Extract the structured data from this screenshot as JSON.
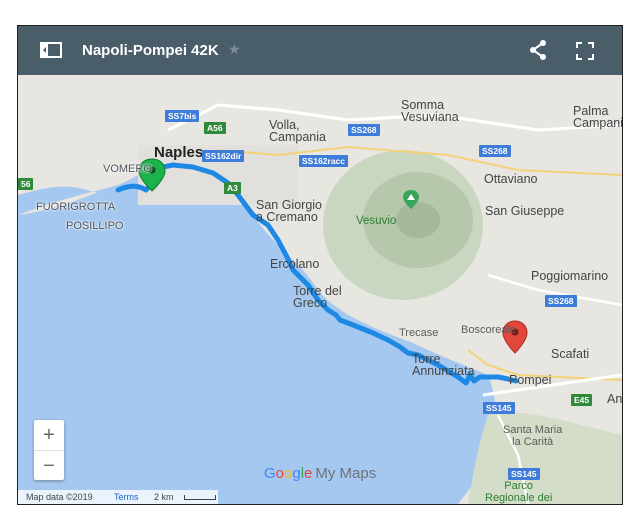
{
  "header": {
    "title": "Napoli-Pompei 42K",
    "star_glyph": "★",
    "bg_color": "#4a5e6a"
  },
  "map": {
    "places": {
      "naples": "Naples",
      "volla": "Volla,\nCampania",
      "somma": "Somma\nVesuviana",
      "ottaviano": "Ottaviano",
      "san_giuseppe": "San Giuseppe",
      "palma": "Palma\nCampania",
      "san_giorgio": "San Giorgio\na Cremano",
      "vesuvio": "Vesuvio",
      "ercolano": "Ercolano",
      "torre_greco": "Torre del\nGreco",
      "poggiomarino": "Poggiomarino",
      "trecase": "Trecase",
      "boscoreale": "Boscoreale",
      "scafati": "Scafati",
      "torre_annunziata": "Torre\nAnnunziata",
      "pompei": "Pompei",
      "santa_maria": "Santa Maria\nla Carità",
      "parco": "Parco\nRegionale dei\nMonti Lattari",
      "vomero": "VOMERO",
      "fuorigrotta": "FUORIGROTTA",
      "posillipo": "POSILLIPO",
      "an": "An"
    },
    "shields": {
      "ss7bis": "SS7bis",
      "a56": "A56",
      "ss162dir": "SS162dir",
      "ss268_a": "SS268",
      "ss162racc": "SS162racc",
      "ss268_b": "SS268",
      "a3": "A3",
      "ss268_c": "SS268",
      "a56_left": "56",
      "ss145_a": "SS145",
      "e45": "E45",
      "ss145_b": "SS145"
    },
    "route_color": "#1e88e5",
    "water_color": "#a5c8f0",
    "land_color": "#e8e6e1",
    "start_marker_color": "#1bb24b",
    "end_marker_color": "#e2473b"
  },
  "controls": {
    "zoom_in": "+",
    "zoom_out": "−"
  },
  "branding": {
    "google": [
      "G",
      "o",
      "o",
      "g",
      "l",
      "e"
    ],
    "mymaps": "My Maps"
  },
  "footer": {
    "map_data": "Map data ©2019",
    "terms": "Terms",
    "scale": "2 km"
  }
}
